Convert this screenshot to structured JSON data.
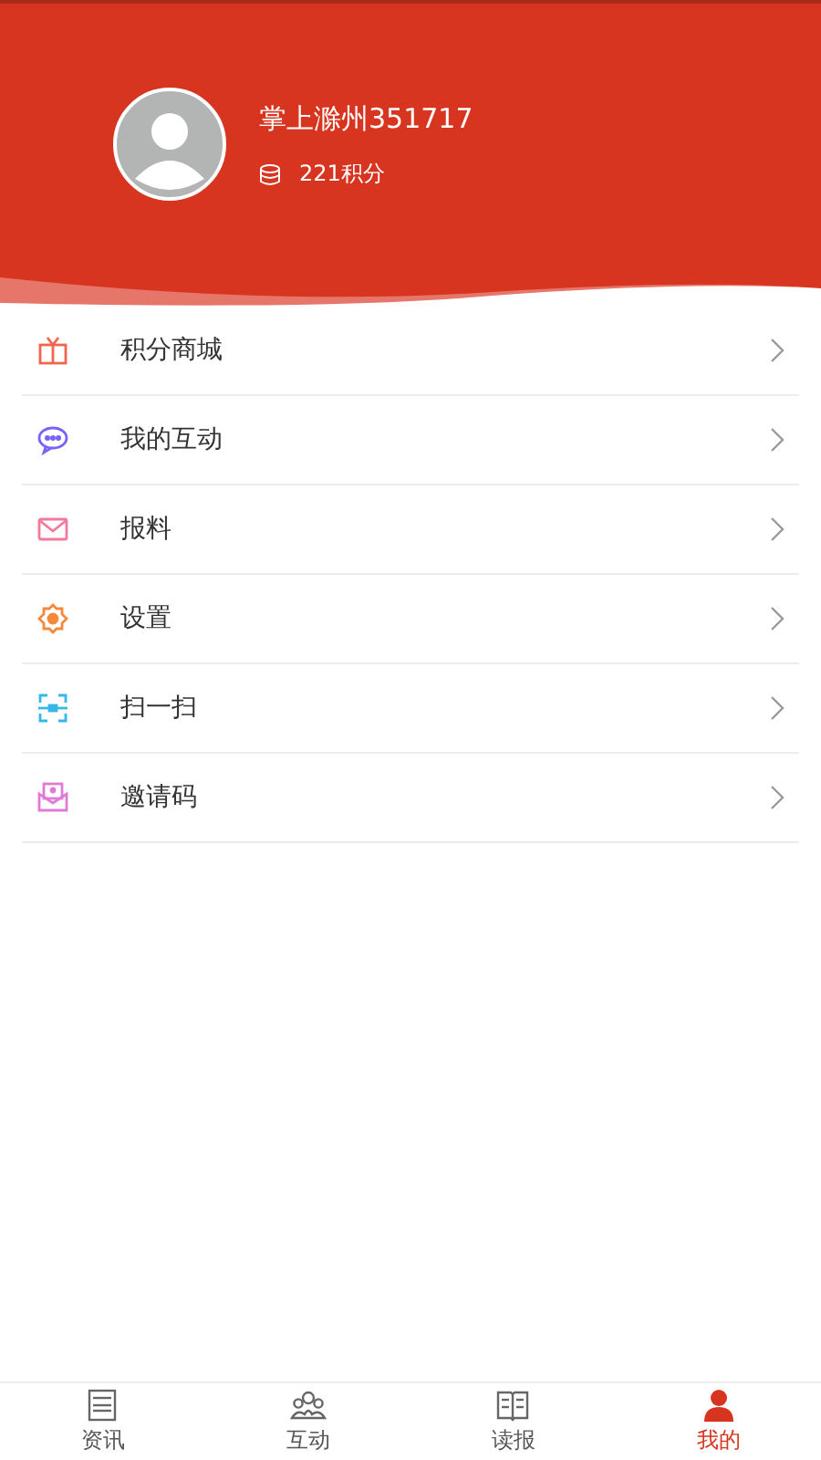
{
  "profile": {
    "name": "掌上滁州351717",
    "points": "221积分"
  },
  "menu": [
    {
      "kind": "gift",
      "label": "积分商城"
    },
    {
      "kind": "chat",
      "label": "我的互动"
    },
    {
      "kind": "mail",
      "label": "报料"
    },
    {
      "kind": "gear",
      "label": "设置"
    },
    {
      "kind": "scan",
      "label": "扫一扫"
    },
    {
      "kind": "invite",
      "label": "邀请码"
    }
  ],
  "tabs": [
    {
      "kind": "news",
      "label": "资讯",
      "selected": false
    },
    {
      "kind": "group",
      "label": "互动",
      "selected": false
    },
    {
      "kind": "book",
      "label": "读报",
      "selected": false
    },
    {
      "kind": "person",
      "label": "我的",
      "selected": true
    }
  ]
}
